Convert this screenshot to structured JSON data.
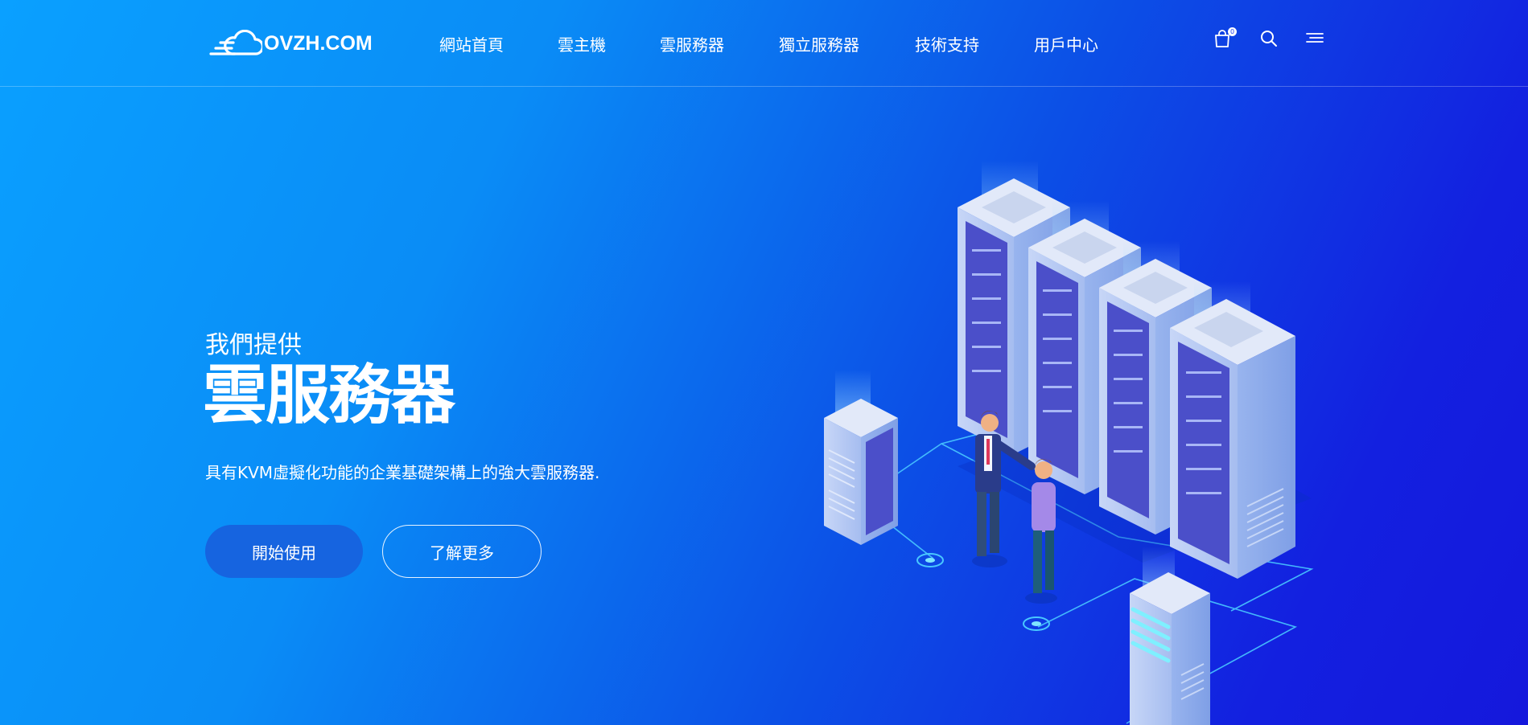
{
  "header": {
    "logo_text": "OVZH.COM",
    "nav": [
      {
        "label": "網站首頁"
      },
      {
        "label": "雲主機"
      },
      {
        "label": "雲服務器"
      },
      {
        "label": "獨立服務器"
      },
      {
        "label": "技術支持"
      },
      {
        "label": "用戶中心"
      }
    ],
    "cart_count": "0",
    "icons": [
      "cart-icon",
      "search-icon",
      "menu-icon"
    ]
  },
  "hero": {
    "subtitle": "我們提供",
    "title": "雲服務器",
    "description": "具有KVM虛擬化功能的企業基礎架構上的強大雲服務器.",
    "primary_button": "開始使用",
    "secondary_button": "了解更多"
  },
  "colors": {
    "gradient_start": "#0aa0ff",
    "gradient_end": "#1518dc",
    "primary_button": "#1664e0",
    "text": "#ffffff"
  }
}
